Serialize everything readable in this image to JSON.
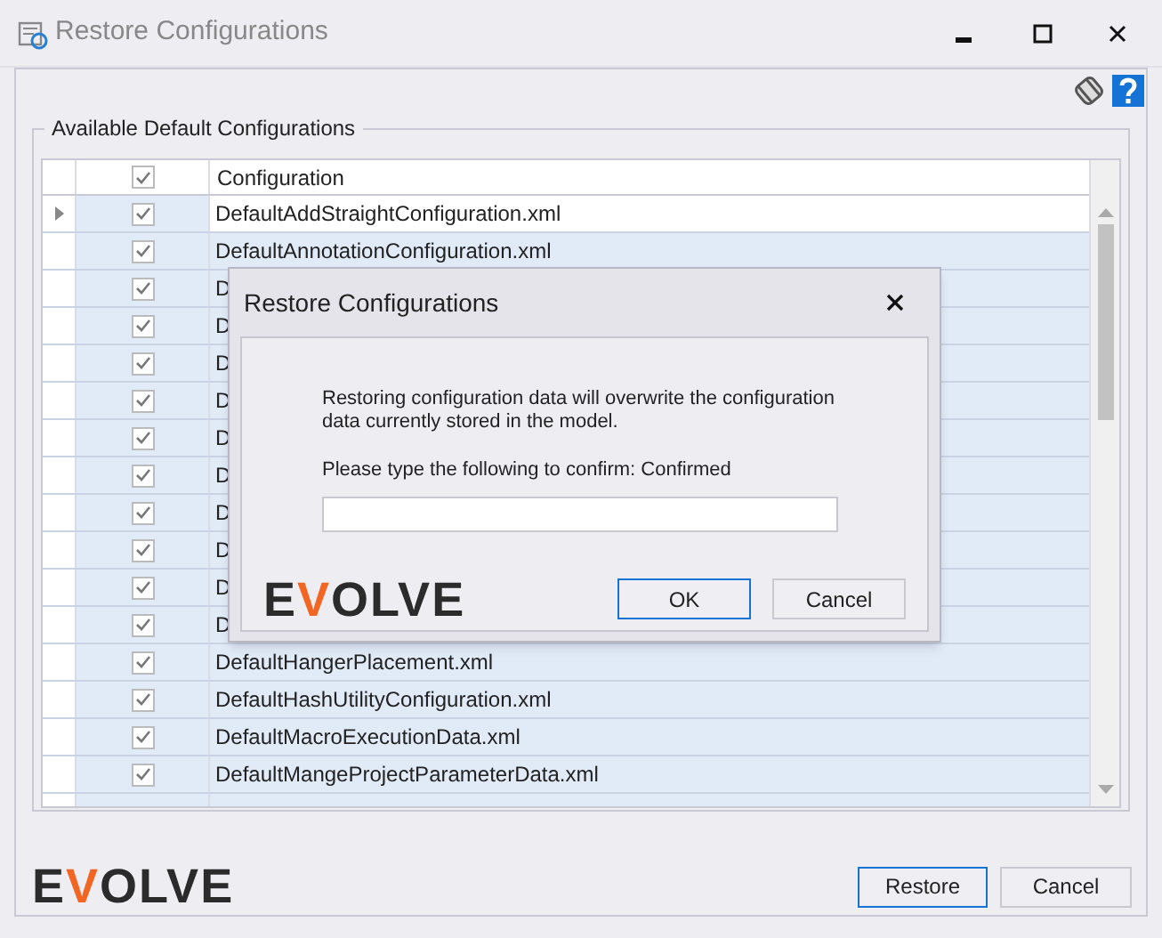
{
  "window": {
    "title": "Restore Configurations"
  },
  "group": {
    "title": "Available Default Configurations"
  },
  "table": {
    "header_checked": true,
    "column_label": "Configuration",
    "rows": [
      {
        "name": "DefaultAddStraightConfiguration.xml",
        "checked": true,
        "current": true
      },
      {
        "name": "DefaultAnnotationConfiguration.xml",
        "checked": true,
        "current": false
      },
      {
        "name": "D",
        "checked": true,
        "current": false
      },
      {
        "name": "D",
        "checked": true,
        "current": false
      },
      {
        "name": "D",
        "checked": true,
        "current": false
      },
      {
        "name": "D",
        "checked": true,
        "current": false
      },
      {
        "name": "D",
        "checked": true,
        "current": false
      },
      {
        "name": "D",
        "checked": true,
        "current": false
      },
      {
        "name": "D",
        "checked": true,
        "current": false
      },
      {
        "name": "D",
        "checked": true,
        "current": false
      },
      {
        "name": "D",
        "checked": true,
        "current": false
      },
      {
        "name": "D",
        "checked": true,
        "current": false
      },
      {
        "name": "DefaultHangerPlacement.xml",
        "checked": true,
        "current": false
      },
      {
        "name": "DefaultHashUtilityConfiguration.xml",
        "checked": true,
        "current": false
      },
      {
        "name": "DefaultMacroExecutionData.xml",
        "checked": true,
        "current": false
      },
      {
        "name": "DefaultMangeProjectParameterData.xml",
        "checked": true,
        "current": false
      }
    ]
  },
  "logo": "EVOLVE",
  "buttons": [
    "Restore",
    "Cancel"
  ],
  "dialog": {
    "title": "Restore Configurations",
    "message": "Restoring configuration data will overwrite the configuration data currently stored in the model.",
    "prompt": "Please type the following to confirm: Confirmed",
    "logo": "EVOLVE",
    "buttons": [
      "OK",
      "Cancel"
    ]
  }
}
